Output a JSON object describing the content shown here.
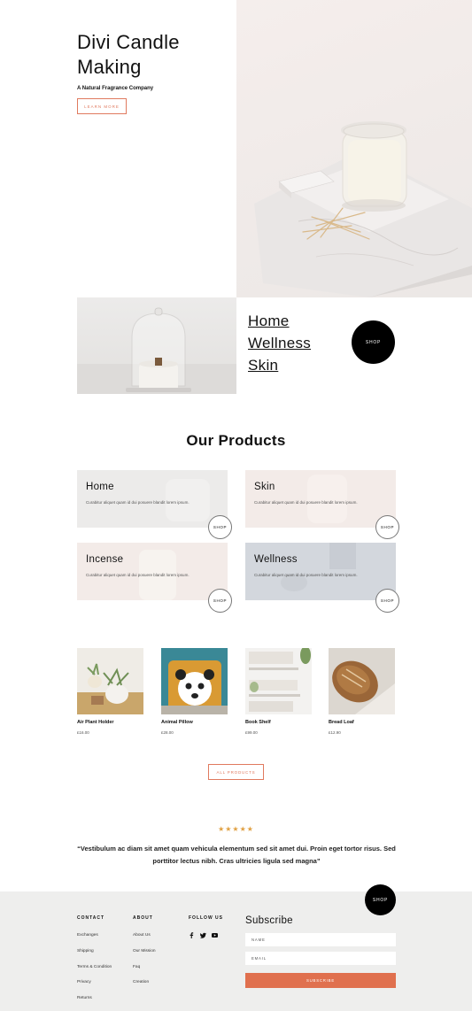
{
  "hero": {
    "title": "Divi Candle Making",
    "subtitle": "A Natural Fragrance Company",
    "cta_label": "LEARN MORE"
  },
  "categories": {
    "links": [
      "Home",
      "Wellness",
      "Skin"
    ],
    "shop_label": "SHOP"
  },
  "products_section": {
    "title": "Our Products",
    "cards": [
      {
        "title": "Home",
        "desc": "Curabitur aliquet quam id dui posuere blandit lorem ipsum.",
        "shop": "SHOP",
        "bg": "#ecebea"
      },
      {
        "title": "Skin",
        "desc": "Curabitur aliquet quam id dui posuere blandit lorem ipsum.",
        "shop": "SHOP",
        "bg": "#f3ebe8"
      },
      {
        "title": "Incense",
        "desc": "Curabitur aliquet quam id dui posuere blandit lorem ipsum.",
        "shop": "SHOP",
        "bg": "#f3ebe8"
      },
      {
        "title": "Wellness",
        "desc": "Curabitur aliquet quam id dui posuere blandit lorem ipsum.",
        "shop": "SHOP",
        "bg": "#d3d7dd"
      }
    ]
  },
  "product_grid": {
    "items": [
      {
        "name": "Air Plant Holder",
        "price": "£16.00"
      },
      {
        "name": "Animal Pillow",
        "price": "£28.00"
      },
      {
        "name": "Book Shelf",
        "price": "£99.00"
      },
      {
        "name": "Bread Loaf",
        "price": "£12.90"
      }
    ],
    "all_products_label": "ALL PRODUCTS"
  },
  "testimonial": {
    "stars": "★★★★★",
    "quote": "“Vestibulum ac diam sit amet quam vehicula elementum sed sit amet dui. Proin eget tortor risus. Sed porttitor lectus nibh. Cras ultricies ligula sed magna”"
  },
  "footer": {
    "shop_label": "SHOP",
    "contact": {
      "heading": "CONTACT",
      "links": [
        "Exchanges",
        "Shipping",
        "Terms & Condition",
        "Privacy",
        "Returns"
      ]
    },
    "about": {
      "heading": "ABOUT",
      "links": [
        "About Us",
        "Our Mission",
        "Faq",
        "Creation"
      ]
    },
    "follow": {
      "heading": "FOLLOW US",
      "icons": [
        "facebook-icon",
        "twitter-icon",
        "youtube-icon"
      ]
    },
    "subscribe": {
      "title": "Subscribe",
      "name_placeholder": "NAME",
      "email_placeholder": "EMAIL",
      "button_label": "SUBSCRIBE"
    }
  },
  "colors": {
    "accent": "#e07a5f",
    "subscribe_button": "#e0704e",
    "footer_bg": "#eeeeed",
    "star": "#e0a042"
  }
}
